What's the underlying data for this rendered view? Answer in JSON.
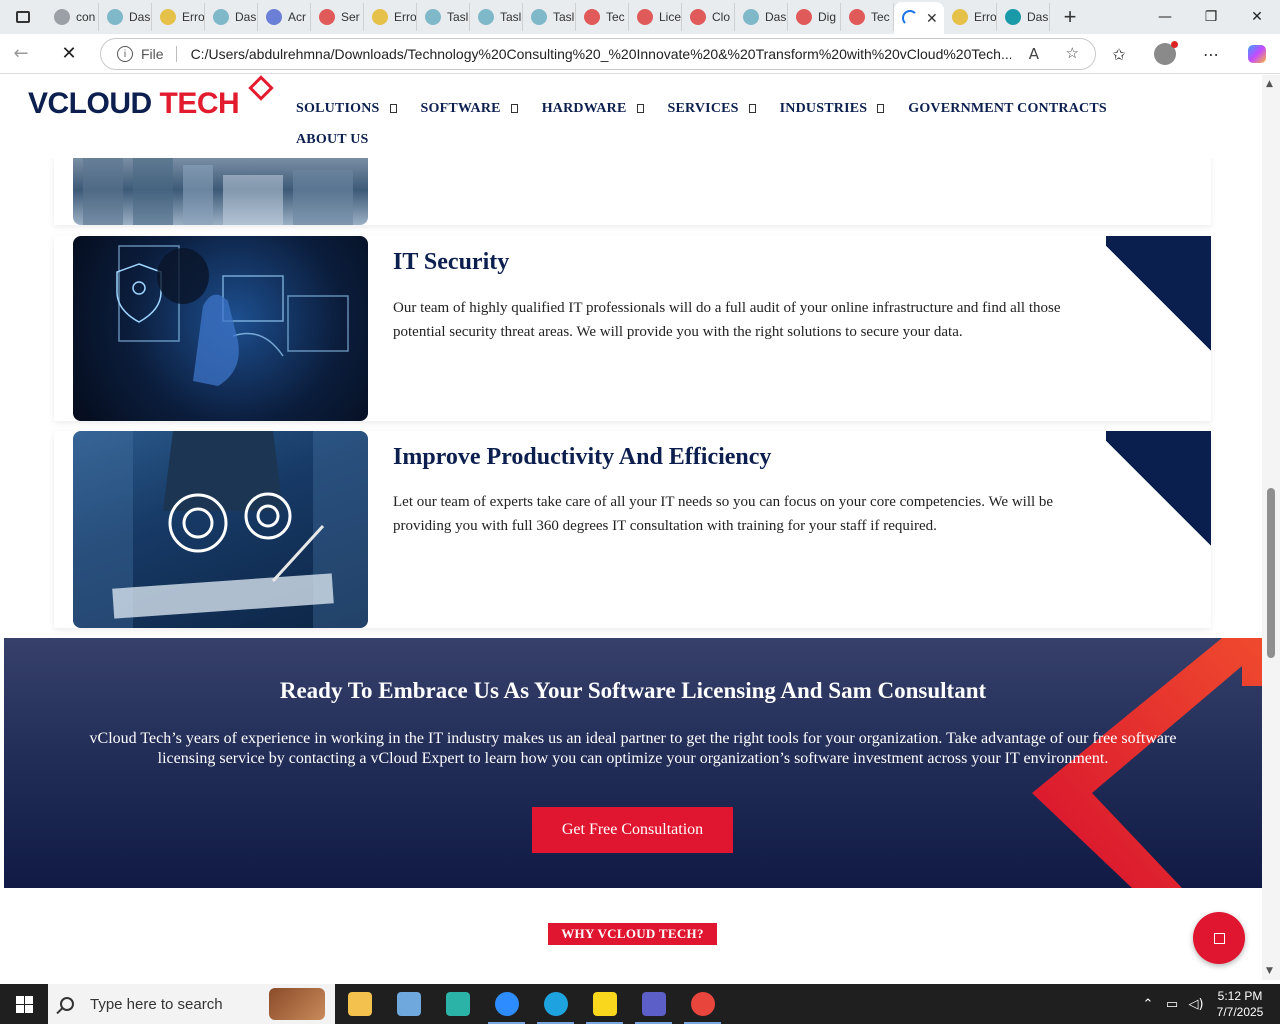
{
  "browser": {
    "tabs": [
      {
        "label": "con",
        "color": "#9aa0a6"
      },
      {
        "label": "Das",
        "color": "#7fb8c9"
      },
      {
        "label": "Erro",
        "color": "#e6c14a"
      },
      {
        "label": "Das",
        "color": "#7fb8c9"
      },
      {
        "label": "Acr",
        "color": "#6b7fd6"
      },
      {
        "label": "Ser",
        "color": "#e05a5a"
      },
      {
        "label": "Erro",
        "color": "#e6c14a"
      },
      {
        "label": "Tasl",
        "color": "#7fb8c9"
      },
      {
        "label": "Tasl",
        "color": "#7fb8c9"
      },
      {
        "label": "Tasl",
        "color": "#7fb8c9"
      },
      {
        "label": "Tec",
        "color": "#e05a5a"
      },
      {
        "label": "Lice",
        "color": "#e05a5a"
      },
      {
        "label": "Clo",
        "color": "#e05a5a"
      },
      {
        "label": "Das",
        "color": "#7fb8c9"
      },
      {
        "label": "Dig",
        "color": "#e05a5a"
      },
      {
        "label": "Tec",
        "color": "#e05a5a"
      }
    ],
    "active_tab_close": "✕",
    "tabs_after": [
      {
        "label": "Erro",
        "color": "#e6c14a"
      },
      {
        "label": "Das",
        "color": "#1a9aa8"
      }
    ],
    "new_tab": "+",
    "file_label": "File",
    "url": "C:/Users/abdulrehmna/Downloads/Technology%20Consulting%20_%20Innovate%20&%20Transform%20with%20vCloud%20Tech....",
    "icons": [
      "back-icon",
      "stop-loading-icon",
      "read-aloud-icon",
      "favorite-star-icon",
      "favorites-icon",
      "profile-avatar-icon",
      "more-icon",
      "copilot-icon"
    ]
  },
  "site": {
    "logo_main": "VCLOUD ",
    "logo_accent": "TECH",
    "nav": [
      {
        "label": "SOLUTIONS",
        "dropdown": true
      },
      {
        "label": "SOFTWARE",
        "dropdown": true
      },
      {
        "label": "HARDWARE",
        "dropdown": true
      },
      {
        "label": "SERVICES",
        "dropdown": true
      },
      {
        "label": "INDUSTRIES",
        "dropdown": true
      },
      {
        "label": "GOVERNMENT CONTRACTS",
        "dropdown": false
      },
      {
        "label": "ABOUT US",
        "dropdown": false
      }
    ]
  },
  "cards": [
    {
      "title": "IT Security",
      "body": "Our team of highly qualified IT professionals will do a full audit of your online infrastructure and find all those potential security threat areas. We will provide you with the right solutions to secure your data."
    },
    {
      "title": "Improve Productivity And Efficiency",
      "body": "Let our team of experts take care of all your IT needs so you can focus on your core competencies. We will be providing you with full 360 degrees IT consultation with training for your staff if required."
    }
  ],
  "cta": {
    "title": "Ready To Embrace Us As Your Software Licensing And Sam Consultant",
    "body": "vCloud Tech’s years of experience in working in the IT industry makes us an ideal partner to get the right tools for your organization. Take advantage of our free software licensing service by contacting a vCloud Expert to learn how you can optimize your organization’s software investment across your IT environment.",
    "button": "Get Free Consultation"
  },
  "why_label": "WHY VCLOUD TECH?",
  "colors": {
    "brand_navy": "#0c1f4f",
    "brand_red": "#e01530"
  },
  "taskbar": {
    "search_placeholder": "Type here to search",
    "apps": [
      {
        "name": "file-explorer-icon",
        "color": "#f2c14e"
      },
      {
        "name": "app-icon",
        "color": "#6fa8dc"
      },
      {
        "name": "app-icon-2",
        "color": "#2ab3a6"
      },
      {
        "name": "zoom-icon",
        "color": "#2d8cff"
      },
      {
        "name": "edge-icon",
        "color": "#1fa3e0"
      },
      {
        "name": "sticky-notes-icon",
        "color": "#f9d71c"
      },
      {
        "name": "teams-icon",
        "color": "#5b5fc7"
      },
      {
        "name": "chrome-icon",
        "color": "#e8453c"
      }
    ],
    "time": "5:12 PM",
    "date": "7/7/2025"
  }
}
